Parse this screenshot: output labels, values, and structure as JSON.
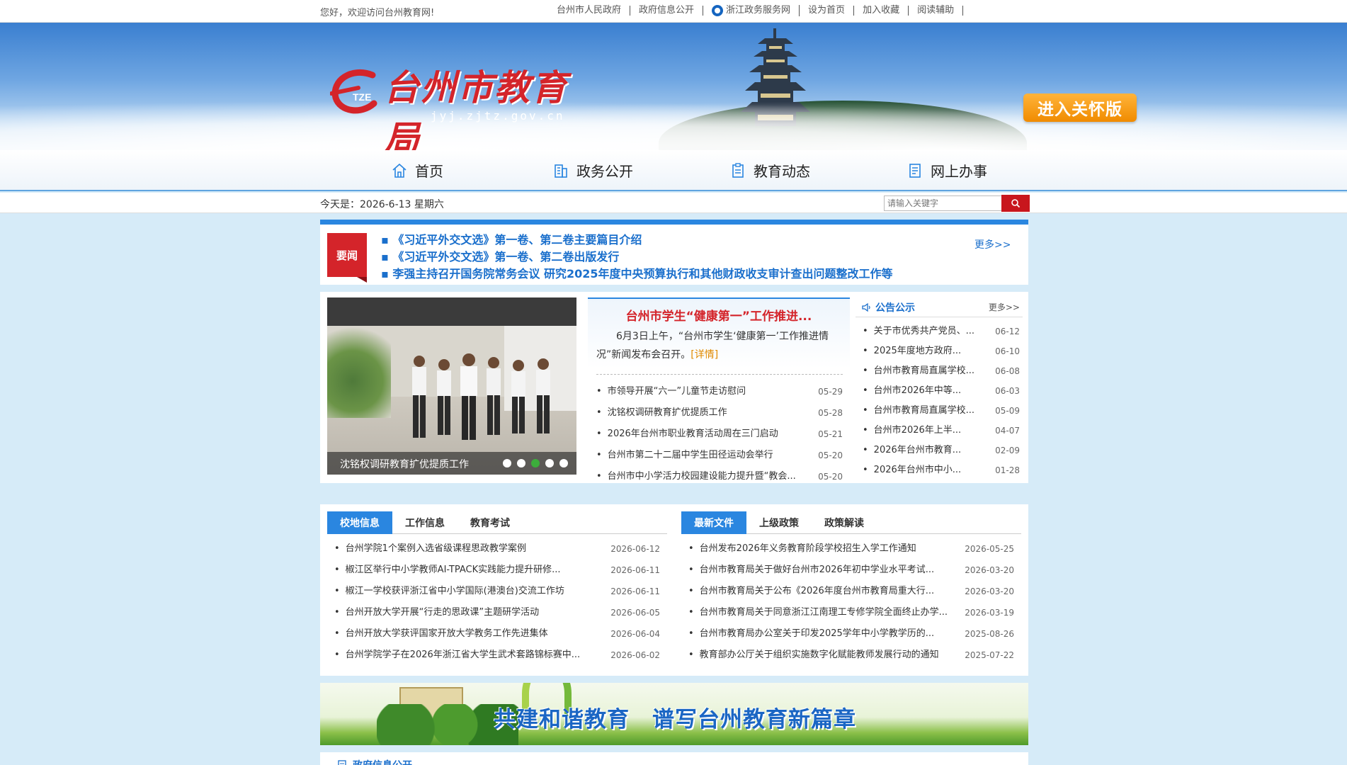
{
  "topbar": {
    "welcome": "您好，欢迎访问台州教育网!",
    "links": [
      "台州市人民政府",
      "政府信息公开",
      "浙江政务服务网",
      "设为首页",
      "加入收藏",
      "阅读辅助"
    ]
  },
  "banner": {
    "logo_mark": "TZE",
    "title": "台州市教育局",
    "domain": "jyj.zjtz.gov.cn",
    "care_button": "进入关怀版"
  },
  "nav": [
    {
      "label": "首页",
      "icon": "home-icon"
    },
    {
      "label": "政务公开",
      "icon": "building-icon"
    },
    {
      "label": "教育动态",
      "icon": "clipboard-icon"
    },
    {
      "label": "网上办事",
      "icon": "document-icon"
    }
  ],
  "datebar": {
    "date": "今天是：2026-6-13 星期六",
    "search_placeholder": "请输入关键字"
  },
  "headline": {
    "tag": "要闻",
    "items": [
      "《习近平外交文选》第一卷、第二卷主要篇目介绍",
      "《习近平外交文选》第一卷、第二卷出版发行",
      "李强主持召开国务院常务会议 研究2025年度中央预算执行和其他财政收支审计查出问题整改工作等"
    ],
    "more": "更多>>"
  },
  "slideshow": {
    "caption": "沈铭权调研教育扩优提质工作",
    "dots": 5,
    "active_dot": 3
  },
  "featured": {
    "title": "台州市学生“健康第一”工作推进...",
    "summary": "6月3日上午，“台州市学生‘健康第一’工作推进情况”新闻发布会召开。",
    "detail": "[详情]",
    "news": [
      {
        "title": "市领导开展“六一”儿童节走访慰问",
        "date": "05-29"
      },
      {
        "title": "沈铭权调研教育扩优提质工作",
        "date": "05-28"
      },
      {
        "title": "2026年台州市职业教育活动周在三门启动",
        "date": "05-21"
      },
      {
        "title": "台州市第二十二届中学生田径运动会举行",
        "date": "05-20"
      },
      {
        "title": "台州市中小学活力校园建设能力提升暨“教会...",
        "date": "05-20"
      }
    ]
  },
  "notice": {
    "title": "公告公示",
    "more": "更多>>",
    "items": [
      {
        "title": "关于市优秀共产党员、...",
        "date": "06-12"
      },
      {
        "title": "2025年度地方政府...",
        "date": "06-10"
      },
      {
        "title": "台州市教育局直属学校...",
        "date": "06-08"
      },
      {
        "title": "台州市2026年中等...",
        "date": "06-03"
      },
      {
        "title": "台州市教育局直属学校...",
        "date": "05-09"
      },
      {
        "title": "台州市2026年上半...",
        "date": "04-07"
      },
      {
        "title": "2026年台州市教育...",
        "date": "02-09"
      },
      {
        "title": "2026年台州市中小...",
        "date": "01-28"
      }
    ]
  },
  "tabs_left": {
    "tabs": [
      "校地信息",
      "工作信息",
      "教育考试"
    ],
    "items": [
      {
        "title": "台州学院1个案例入选省级课程思政教学案例",
        "date": "2026-06-12"
      },
      {
        "title": "椒江区举行中小学教师AI-TPACK实践能力提升研修...",
        "date": "2026-06-11"
      },
      {
        "title": "椒江一学校获评浙江省中小学国际(港澳台)交流工作坊",
        "date": "2026-06-11"
      },
      {
        "title": "台州开放大学开展“行走的思政课”主题研学活动",
        "date": "2026-06-05"
      },
      {
        "title": "台州开放大学获评国家开放大学教务工作先进集体",
        "date": "2026-06-04"
      },
      {
        "title": "台州学院学子在2026年浙江省大学生武术套路锦标赛中...",
        "date": "2026-06-02"
      }
    ]
  },
  "tabs_right": {
    "tabs": [
      "最新文件",
      "上级政策",
      "政策解读"
    ],
    "items": [
      {
        "title": "台州发布2026年义务教育阶段学校招生入学工作通知",
        "date": "2026-05-25"
      },
      {
        "title": "台州市教育局关于做好台州市2026年初中学业水平考试...",
        "date": "2026-03-20"
      },
      {
        "title": "台州市教育局关于公布《2026年度台州市教育局重大行...",
        "date": "2026-03-20"
      },
      {
        "title": "台州市教育局关于同意浙江江南理工专修学院全面终止办学...",
        "date": "2026-03-19"
      },
      {
        "title": "台州市教育局办公室关于印发2025学年中小学教学历的...",
        "date": "2025-08-26"
      },
      {
        "title": "教育部办公厅关于组织实施数字化赋能教师发展行动的通知",
        "date": "2025-07-22"
      }
    ]
  },
  "slogan": "共建和谐教育　谱写台州教育新篇章",
  "bottom_section": "政府信息公开",
  "colors": {
    "brand_red": "#d4242a",
    "accent_blue": "#2a86e0",
    "care_orange": "#f08b00"
  }
}
